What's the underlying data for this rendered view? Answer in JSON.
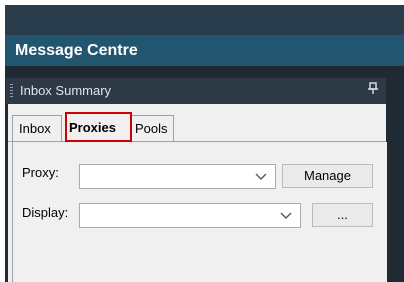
{
  "window": {
    "title": "Message Centre"
  },
  "panel": {
    "title": "Inbox Summary",
    "pin_icon": "pin-icon"
  },
  "tabs": [
    {
      "label": "Inbox",
      "selected": false
    },
    {
      "label": "Proxies",
      "selected": true
    },
    {
      "label": "Pools",
      "selected": false
    }
  ],
  "form": {
    "proxy": {
      "label": "Proxy:",
      "value": "",
      "button": "Manage"
    },
    "display": {
      "label": "Display:",
      "value": "",
      "button": "..."
    }
  },
  "colors": {
    "header_bg": "#22556f",
    "highlight": "#d00000"
  }
}
